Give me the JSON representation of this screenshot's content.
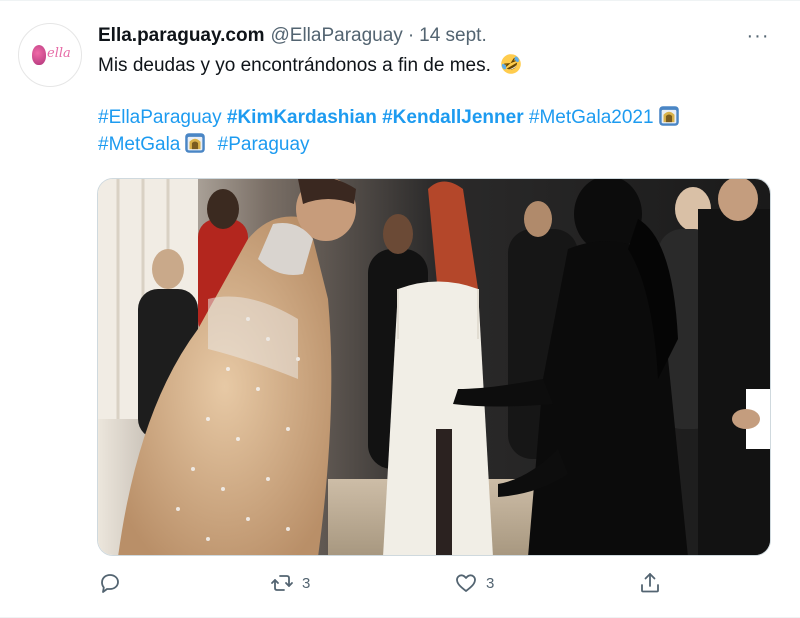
{
  "author": {
    "avatar_text": "ella",
    "name": "Ella.paraguay.com",
    "handle": "@EllaParaguay",
    "separator": "·",
    "date": "14 sept."
  },
  "menu": {
    "more_label": "···"
  },
  "tweet": {
    "text": "Mis deudas y yo encontrándonos a fin de mes.",
    "emoji_laugh": "rolling-on-floor-laughing-emoji",
    "hashtags": {
      "h1": "#EllaParaguay",
      "h2": "#KimKardashian",
      "h3": "#KendallJenner",
      "h4": "#MetGala2021",
      "h5": "#MetGala",
      "h6": "#Paraguay"
    },
    "emoji_metgala": "met-gala-emoji"
  },
  "media": {
    "description_icon": "photo"
  },
  "actions": {
    "reply_count": "",
    "retweet_count": "3",
    "like_count": "3",
    "share_count": ""
  },
  "colors": {
    "link": "#1d9bf0",
    "secondary": "#536471",
    "text": "#0f1419"
  }
}
